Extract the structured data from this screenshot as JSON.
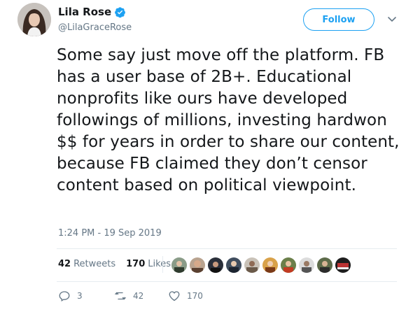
{
  "author": {
    "display_name": "Lila Rose",
    "handle": "@LilaGraceRose"
  },
  "follow_label": "Follow",
  "tweet": {
    "text": "Some say just move off the platform. FB has a user base of 2B+. Educational nonprofits like ours have developed followings of millions, investing hardwon $$ for years in order to share our content, because FB claimed they don’t censor content based on political viewpoint.",
    "timestamp": "1:24 PM - 19 Sep 2019"
  },
  "stats": {
    "retweets_count": "42",
    "retweets_label": "Retweets",
    "likes_count": "170",
    "likes_label": "Likes"
  },
  "actions": {
    "reply_count": "3",
    "retweet_count": "42",
    "like_count": "170"
  },
  "colors": {
    "accent": "#1da1f2",
    "text": "#14171a",
    "muted": "#657786",
    "divider": "#e6ecf0"
  },
  "icons": [
    "verified-badge-icon",
    "chevron-down-icon",
    "reply-icon",
    "retweet-icon",
    "like-icon"
  ]
}
